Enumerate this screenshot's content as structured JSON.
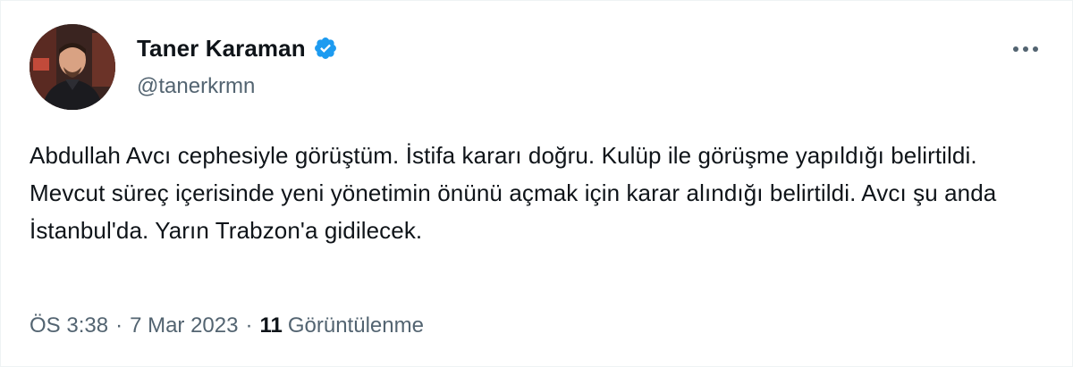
{
  "author": {
    "display_name": "Taner Karaman",
    "handle": "@tanerkrmn",
    "verified": true,
    "verified_color": "#1d9bf0"
  },
  "tweet": {
    "text": "Abdullah Avcı cephesiyle görüştüm. İstifa kararı doğru. Kulüp ile görüşme yapıldığı belirtildi. Mevcut süreç içerisinde yeni yönetimin önünü açmak için karar alındığı belirtildi. Avcı şu anda İstanbul'da. Yarın Trabzon'a gidilecek."
  },
  "meta": {
    "time": "ÖS 3:38",
    "separator": "·",
    "date": "7 Mar 2023",
    "views_count": "11",
    "views_label": "Görüntülenme"
  },
  "icons": {
    "more": "more-options-icon",
    "verified": "verified-badge-icon"
  },
  "colors": {
    "text_primary": "#0f1419",
    "text_secondary": "#536471",
    "accent": "#1d9bf0"
  }
}
